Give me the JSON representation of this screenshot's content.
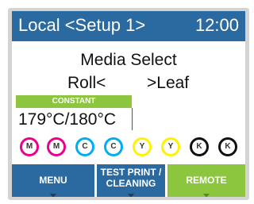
{
  "header": {
    "title": "Local <Setup 1>",
    "clock": "12:00"
  },
  "content": {
    "line1": "Media Select",
    "option_left": "Roll<",
    "option_right": ">Leaf",
    "constant_label": "CONSTANT",
    "temperature": "179°C/180°C"
  },
  "inks": [
    {
      "label": "M",
      "color": "#ec008c"
    },
    {
      "label": "M",
      "color": "#ec008c"
    },
    {
      "label": "C",
      "color": "#00aeef"
    },
    {
      "label": "C",
      "color": "#00aeef"
    },
    {
      "label": "Y",
      "color": "#fff200"
    },
    {
      "label": "Y",
      "color": "#fff200"
    },
    {
      "label": "K",
      "color": "#111111"
    },
    {
      "label": "K",
      "color": "#111111"
    }
  ],
  "softkeys": {
    "menu": "MENU",
    "test_print_line1": "TEST PRINT /",
    "test_print_line2": "CLEANING",
    "remote": "REMOTE"
  },
  "colors": {
    "title_bar": "#2a6aa1",
    "accent_green": "#8cc63f"
  }
}
